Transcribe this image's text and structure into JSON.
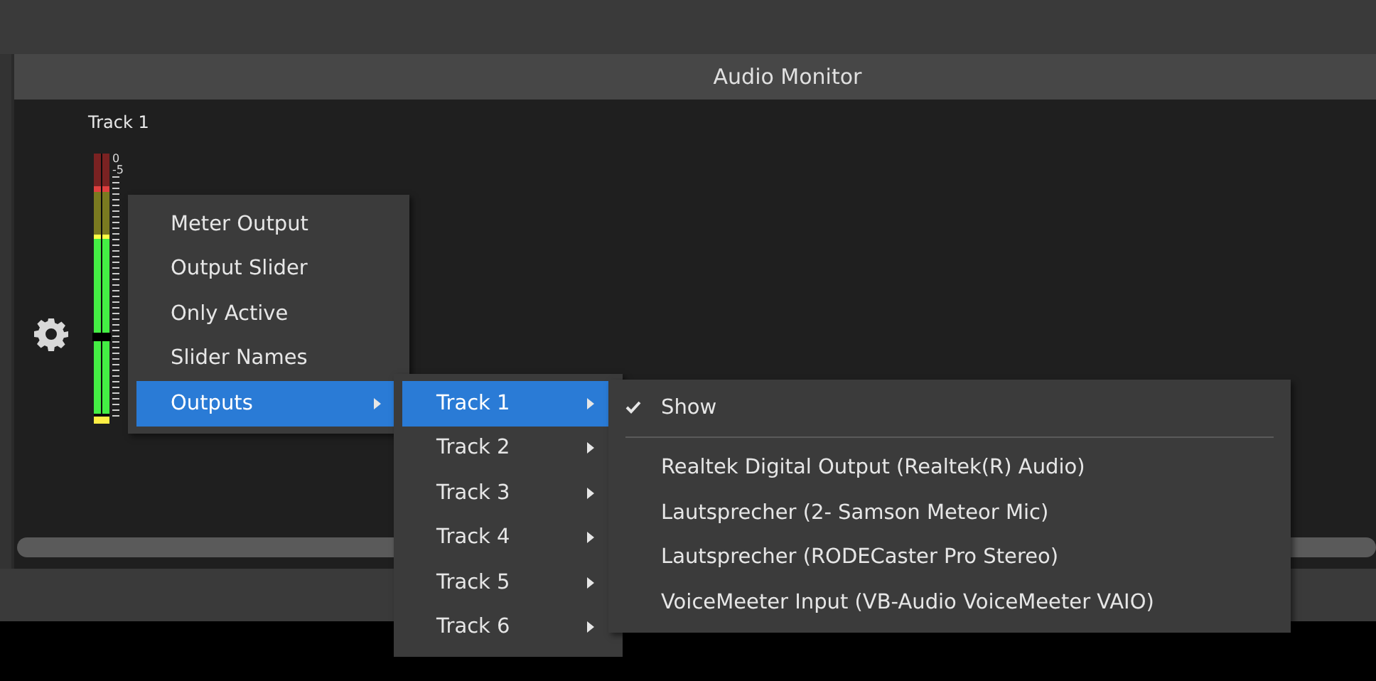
{
  "dock": {
    "title": "Audio Monitor"
  },
  "track": {
    "name": "Track 1",
    "scale": [
      "0",
      "-5"
    ],
    "volume": {
      "level": 0.32
    }
  },
  "menu": [
    {
      "label": "Meter Output",
      "selected": false,
      "submenu": false
    },
    {
      "label": "Output Slider",
      "selected": false,
      "submenu": false
    },
    {
      "label": "Only Active",
      "selected": false,
      "submenu": false
    },
    {
      "label": "Slider Names",
      "selected": false,
      "submenu": false
    },
    {
      "label": "Outputs",
      "selected": true,
      "submenu": true
    }
  ],
  "outputs_menu": [
    {
      "label": "Track 1",
      "selected": true
    },
    {
      "label": "Track 2",
      "selected": false
    },
    {
      "label": "Track 3",
      "selected": false
    },
    {
      "label": "Track 4",
      "selected": false
    },
    {
      "label": "Track 5",
      "selected": false
    },
    {
      "label": "Track 6",
      "selected": false
    }
  ],
  "track_menu": [
    {
      "kind": "check",
      "label": "Show",
      "checked": true
    },
    {
      "kind": "separator"
    },
    {
      "kind": "device",
      "label": "Realtek Digital Output (Realtek(R) Audio)"
    },
    {
      "kind": "device",
      "label": "Lautsprecher (2- Samson Meteor Mic)"
    },
    {
      "kind": "device",
      "label": "Lautsprecher (RODECaster Pro Stereo)"
    },
    {
      "kind": "device",
      "label": "VoiceMeeter Input (VB-Audio VoiceMeeter VAIO)"
    }
  ]
}
